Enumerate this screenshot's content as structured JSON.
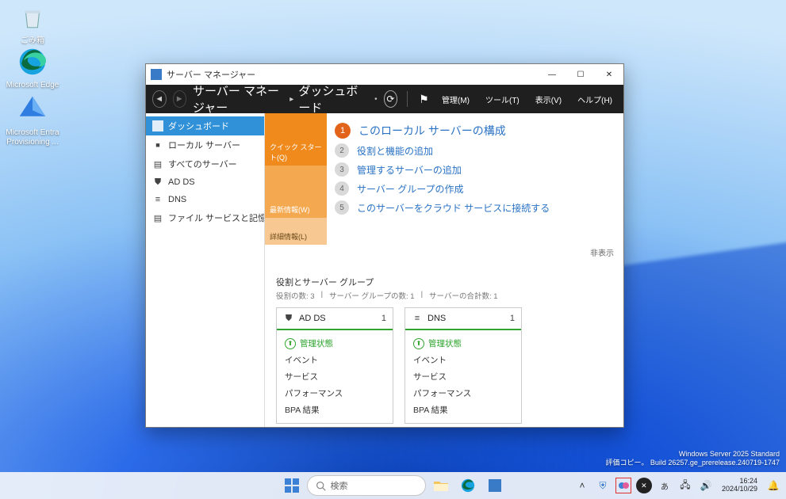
{
  "desktop_icons": {
    "recycle": "ごみ箱",
    "edge": "Microsoft Edge",
    "entra": "Microsoft Entra Provisioning ..."
  },
  "watermark": {
    "l1": "Windows Server 2025 Standard",
    "l2": "評価コピー。  Build 26257.ge_prerelease.240719-1747"
  },
  "window": {
    "title": "サーバー マネージャー",
    "breadcrumb1": "サーバー マネージャー",
    "breadcrumb2": "ダッシュボード",
    "menus": {
      "manage": "管理(M)",
      "tools": "ツール(T)",
      "view": "表示(V)",
      "help": "ヘルプ(H)"
    }
  },
  "sidebar": [
    {
      "label": "ダッシュボード",
      "icon": "dash",
      "selected": true
    },
    {
      "label": "ローカル サーバー",
      "icon": "srv"
    },
    {
      "label": "すべてのサーバー",
      "icon": "all"
    },
    {
      "label": "AD DS",
      "icon": "ad"
    },
    {
      "label": "DNS",
      "icon": "dns"
    },
    {
      "label": "ファイル サービスと記憶域サ...",
      "icon": "file"
    }
  ],
  "welcome": {
    "tabs": {
      "quick": "クイック スタート(Q)",
      "whatsnew": "最新情報(W)",
      "learn": "詳細情報(L)"
    },
    "steps": [
      {
        "n": "1",
        "text": "このローカル サーバーの構成",
        "primary": true
      },
      {
        "n": "2",
        "text": "役割と機能の追加"
      },
      {
        "n": "3",
        "text": "管理するサーバーの追加"
      },
      {
        "n": "4",
        "text": "サーバー グループの作成"
      },
      {
        "n": "5",
        "text": "このサーバーをクラウド サービスに接続する"
      }
    ],
    "hide": "非表示"
  },
  "groups": {
    "title": "役割とサーバー グループ",
    "sub_roles": "役割の数: 3",
    "sub_groups": "サーバー グループの数: 1",
    "sub_total": "サーバーの合計数: 1",
    "tiles": [
      {
        "icon": "⛊",
        "name": "AD DS",
        "count": "1",
        "rows": [
          "管理状態",
          "イベント",
          "サービス",
          "パフォーマンス",
          "BPA 結果"
        ]
      },
      {
        "icon": "≡",
        "name": "DNS",
        "count": "1",
        "rows": [
          "管理状態",
          "イベント",
          "サービス",
          "パフォーマンス",
          "BPA 結果"
        ]
      }
    ]
  },
  "taskbar": {
    "search_placeholder": "検索",
    "time": "16:24",
    "date": "2024/10/29"
  }
}
